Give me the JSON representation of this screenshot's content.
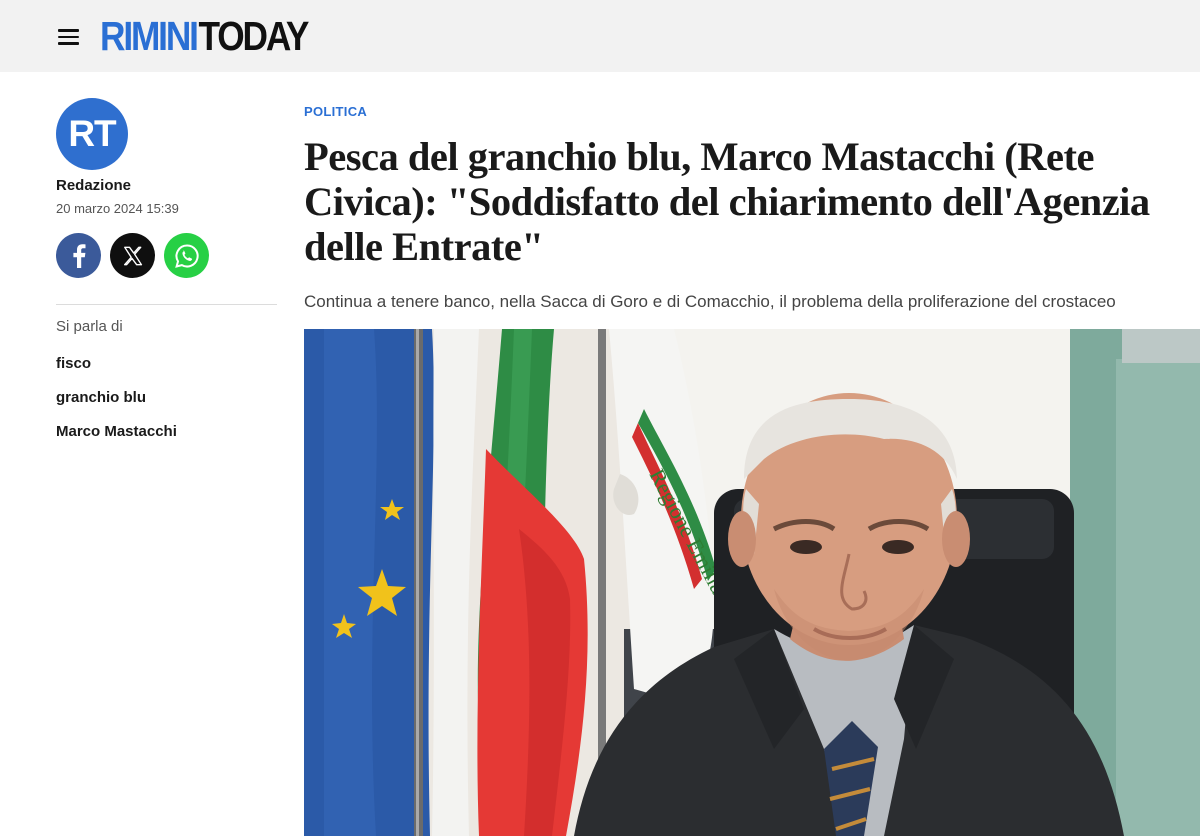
{
  "header": {
    "menu_icon": "hamburger-menu-icon",
    "logo_part1": "RIMINI",
    "logo_part2": "TODAY",
    "logo_color_primary": "#2a6fd4",
    "logo_color_secondary": "#111111"
  },
  "author": {
    "avatar_initials": "RT",
    "avatar_color": "#2f6fcf",
    "name": "Redazione",
    "date": "20 marzo 2024 15:39"
  },
  "share": [
    {
      "network": "facebook",
      "icon": "facebook-icon",
      "color": "#3b5a9a"
    },
    {
      "network": "x",
      "icon": "x-icon",
      "color": "#0f0f0f"
    },
    {
      "network": "whatsapp",
      "icon": "whatsapp-icon",
      "color": "#27d045"
    }
  ],
  "tags": {
    "label": "Si parla di",
    "items": [
      "fisco",
      "granchio blu",
      "Marco Mastacchi"
    ]
  },
  "article": {
    "category": "POLITICA",
    "category_color": "#2a6fd4",
    "headline": "Pesca del granchio blu, Marco Mastacchi (Rete Civica): \"Soddisfatto del chiarimento dell'Agenzia delle Entrate\"",
    "subtitle": "Continua a tenere banco, nella Sacca di Goro e di Comacchio, il problema della proliferazione del crostaceo",
    "photo_banner_text": "Regione Emilia"
  }
}
